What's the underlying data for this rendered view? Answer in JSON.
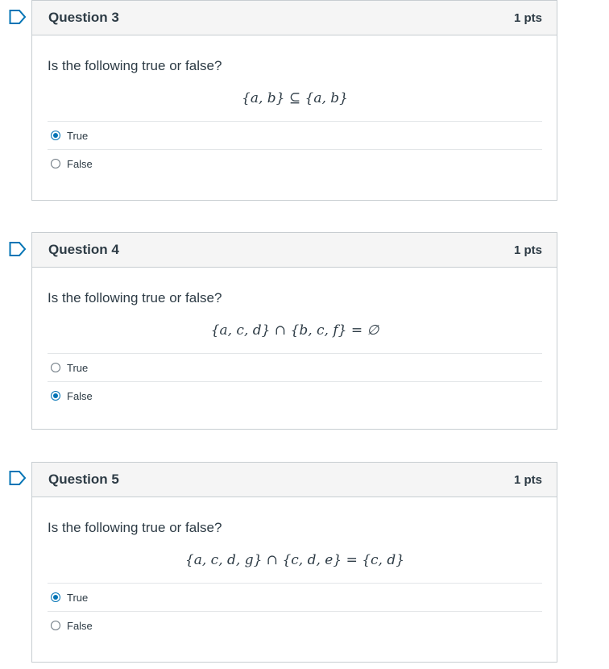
{
  "accent_color": "#0374b5",
  "questions": [
    {
      "title": "Question 3",
      "points": "1 pts",
      "prompt": "Is the following true or false?",
      "math": "{a, b} ⊆ {a, b}",
      "answers": [
        {
          "label": "True",
          "selected": true
        },
        {
          "label": "False",
          "selected": false
        }
      ]
    },
    {
      "title": "Question 4",
      "points": "1 pts",
      "prompt": "Is the following true or false?",
      "math": "{a, c, d} ∩ {b, c, f} = ∅",
      "answers": [
        {
          "label": "True",
          "selected": false
        },
        {
          "label": "False",
          "selected": true
        }
      ]
    },
    {
      "title": "Question 5",
      "points": "1 pts",
      "prompt": "Is the following true or false?",
      "math": "{a, c, d, g} ∩ {c, d, e} = {c, d}",
      "answers": [
        {
          "label": "True",
          "selected": true
        },
        {
          "label": "False",
          "selected": false
        }
      ]
    }
  ]
}
